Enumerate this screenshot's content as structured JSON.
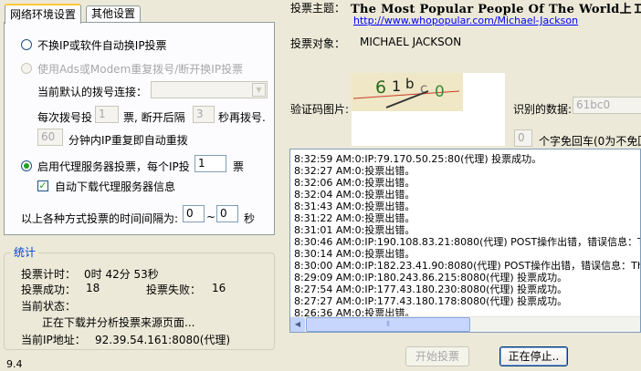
{
  "tabs": [
    {
      "label": "网络环境设置",
      "active": true
    },
    {
      "label": "其他设置",
      "active": false
    }
  ],
  "network": {
    "option_no_ip": "不换IP或软件自动换IP投票",
    "option_adsl": "使用Ads或Modem重复拨号/断开换IP投票",
    "current_dial_label": "当前默认的拨号连接：",
    "current_dial_value": "",
    "dial_every_label": "每次拨号投",
    "dial_every_value": "1",
    "dial_every_unit": "票, 断开后隔",
    "redial_wait_value": "3",
    "redial_wait_unit": "秒再拨号.",
    "auto_redial_value": "60",
    "auto_redial_label": "分钟内IP重复即自动重拨",
    "option_proxy": "启用代理服务器投票，每个IP投",
    "proxy_votes_value": "1",
    "proxy_votes_unit": "票",
    "auto_download_label": "自动下载代理服务器信息",
    "interval_label": "以上各种方式投票的时间间隔为:",
    "interval_from": "0",
    "interval_sep": "~",
    "interval_to": "0",
    "interval_unit": "秒",
    "selected_option": "proxy",
    "auto_download_checked": true
  },
  "stats": {
    "title": "统计",
    "vote_timer_label": "投票计时：",
    "vote_timer_value": "0时 42分 53秒",
    "success_label": "投票成功：",
    "success_value": "18",
    "fail_label": "投票失败：",
    "fail_value": "16",
    "status_label": "当前状态：",
    "status_value": "正在下载并分析投票来源页面...",
    "ip_label": "当前IP地址：",
    "ip_value": "92.39.54.161:8080(代理)"
  },
  "version": "9.4",
  "vote": {
    "topic_label": "投票主题：",
    "topic_value": "The Most Popular People Of The World上Ｉ",
    "topic_url": "http://www.whopopular.com/Michael-Jackson",
    "target_label": "投票对象：",
    "target_value": "MICHAEL JACKSON",
    "captcha_label": "验证码图片:",
    "captcha_text": "61bc0",
    "recognized_label": "识别的数据:",
    "recognized_value": "61bc0",
    "free_count_value": "0",
    "free_count_label": "个字免回车(0为不免回"
  },
  "log": [
    "8:32:59 AM:0:IP:79.170.50.25:80(代理) 投票成功。",
    "8:32:27 AM:0:投票出错。",
    "8:32:06 AM:0:投票出错。",
    "8:32:04 AM:0:投票出错。",
    "8:31:43 AM:0:投票出错。",
    "8:31:22 AM:0:投票出错。",
    "8:31:01 AM:0:投票出错。",
    "8:30:46 AM:0:IP:190.108.83.21:8080(代理) POST操作出错，错误信息：The",
    "8:30:14 AM:0:投票出错。",
    "8:30:00 AM:0:IP:182.23.41.90:8080(代理) POST操作出错，错误信息：The u",
    "8:29:09 AM:0:IP:180.243.86.215:8080(代理) 投票成功。",
    "8:27:54 AM:0:IP:177.43.180.230:8080(代理) 投票成功。",
    "8:27:27 AM:0:IP:177.43.180.178:8080(代理) 投票成功。",
    "8:26:36 AM:0:投票出错。"
  ],
  "buttons": {
    "start": "开始投票",
    "stop": "正在停止.."
  }
}
